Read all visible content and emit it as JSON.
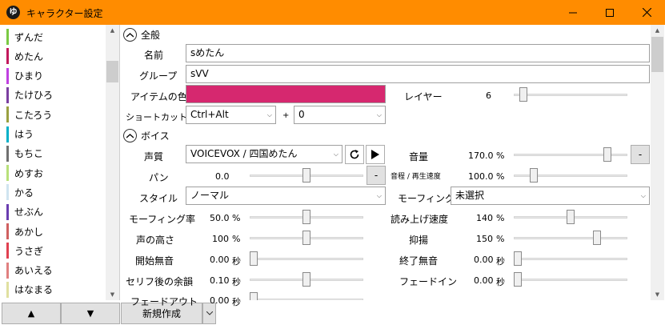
{
  "window": {
    "title": "キャラクター設定",
    "icon_glyph": "ゆ",
    "accent_color": "#ff8c00"
  },
  "sidebar": {
    "items": [
      {
        "label": "ずんだ",
        "color": "#7ac943"
      },
      {
        "label": "めたん",
        "color": "#c2185b"
      },
      {
        "label": "ひまり",
        "color": "#c040e0"
      },
      {
        "label": "たけひろ",
        "color": "#7b3fa0"
      },
      {
        "label": "こたろう",
        "color": "#9aa040"
      },
      {
        "label": "はう",
        "color": "#00b0c8"
      },
      {
        "label": "もちこ",
        "color": "#707070"
      },
      {
        "label": "めすお",
        "color": "#b8e07a"
      },
      {
        "label": "かる",
        "color": "#d0e4f0"
      },
      {
        "label": "せぶん",
        "color": "#6a3db0"
      },
      {
        "label": "あかし",
        "color": "#d06060"
      },
      {
        "label": "うさぎ",
        "color": "#e04050"
      },
      {
        "label": "あいえる",
        "color": "#e08080"
      },
      {
        "label": "はなまる",
        "color": "#e0e0a0"
      }
    ]
  },
  "bottom": {
    "up_glyph": "▲",
    "down_glyph": "▼",
    "new_label": "新規作成"
  },
  "general": {
    "heading": "全般",
    "name_label": "名前",
    "name_value": "sめたん",
    "group_label": "グループ",
    "group_value": "sVV",
    "item_color_label": "アイテムの色",
    "item_color": "#d6286f",
    "layer_label": "レイヤー",
    "layer_value": "6",
    "layer_level": 0.05,
    "shortcut_label": "ショートカットキー",
    "shortcut_modifier": "Ctrl+Alt",
    "shortcut_plus": "+",
    "shortcut_key": "0"
  },
  "voice": {
    "heading": "ボイス",
    "voice_label": "声質",
    "voice_value": "VOICEVOX / 四国めたん",
    "volume_label": "音量",
    "volume_value": "170.0",
    "volume_unit": "%",
    "volume_level": 0.85,
    "pan_label": "パン",
    "pan_value": "0.0",
    "pan_level": 0.5,
    "pitch_speed_label": "音程 / 再生速度",
    "pitch_speed_value": "100.0",
    "pitch_speed_unit": "%",
    "pitch_speed_level": 0.15,
    "style_label": "スタイル",
    "style_value": "ノーマル",
    "morph_label": "モーフィング",
    "morph_value": "未選択",
    "morph_rate_label": "モーフィング率",
    "morph_rate_value": "50.0",
    "morph_rate_unit": "%",
    "morph_rate_level": 0.5,
    "speed_label": "読み上げ速度",
    "speed_value": "140",
    "speed_unit": "%",
    "speed_level": 0.5,
    "pitch_label": "声の高さ",
    "pitch_value": "100",
    "pitch_unit": "%",
    "pitch_level": 0.5,
    "intonation_label": "抑揚",
    "intonation_value": "150",
    "intonation_unit": "%",
    "intonation_level": 0.75,
    "start_silence_label": "開始無音",
    "start_silence_value": "0.00",
    "start_silence_unit": "秒",
    "start_silence_level": 0.0,
    "end_silence_label": "終了無音",
    "end_silence_value": "0.00",
    "end_silence_unit": "秒",
    "end_silence_level": 0.0,
    "after_line_label": "セリフ後の余韻",
    "after_line_value": "0.10",
    "after_line_unit": "秒",
    "after_line_level": 0.5,
    "fade_in_label": "フェードイン",
    "fade_in_value": "0.00",
    "fade_in_unit": "秒",
    "fade_in_level": 0.0,
    "fade_out_label": "フェードアウト",
    "fade_out_value": "0.00",
    "fade_out_unit": "秒",
    "fade_out_level": 0.0,
    "minus_glyph": "-"
  }
}
